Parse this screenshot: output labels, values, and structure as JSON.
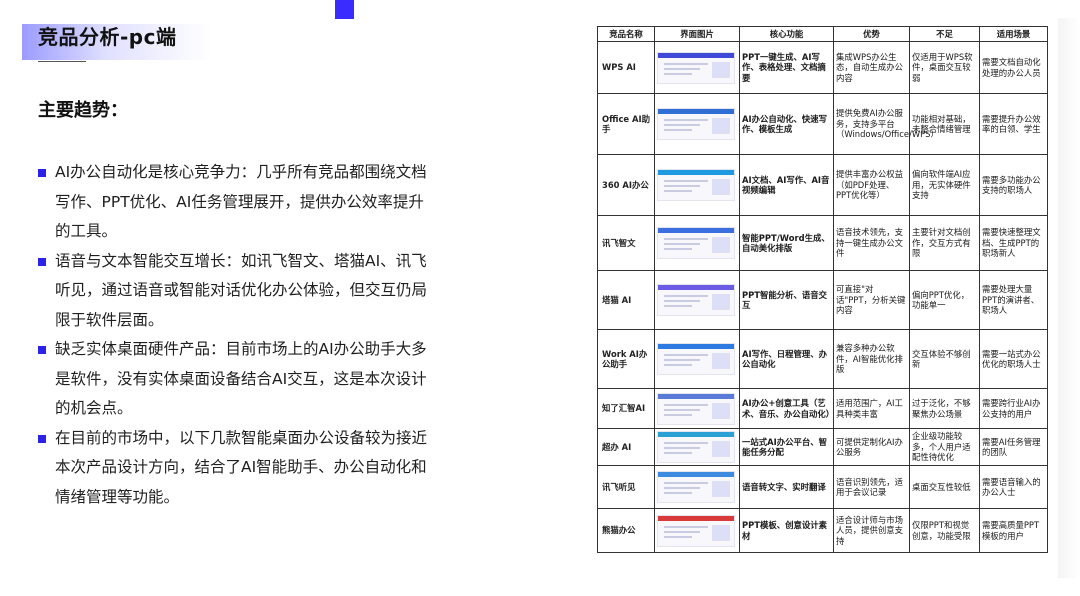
{
  "page": {
    "title": "竞品分析-pc端",
    "section_heading": "主要趋势：",
    "trends": [
      "AI办公自动化是核心竞争力：几乎所有竞品都围绕文档写作、PPT优化、AI任务管理展开，提供办公效率提升的工具。",
      "语音与文本智能交互增长：如讯飞智文、塔猫AI、讯飞听见，通过语音或智能对话优化办公体验，但交互仍局限于软件层面。",
      "缺乏实体桌面硬件产品：目前市场上的AI办公助手大多是软件，没有实体桌面设备结合AI交互，这是本次设计的机会点。",
      "在目前的市场中，以下几款智能桌面办公设备较为接近本次产品设计方向，结合了AI智能助手、办公自动化和情绪管理等功能。"
    ]
  },
  "colors": {
    "accent": "#3a2bff",
    "bullet": "#2a22e6"
  },
  "table": {
    "headers": [
      "竞品名称",
      "界面图片",
      "核心功能",
      "优势",
      "不足",
      "适用场景"
    ],
    "rows": [
      {
        "name": "WPS AI",
        "func": "PPT一键生成、AI写作、表格处理、文档摘要",
        "adv": "集成WPS办公生态，自动生成办公内容",
        "dis": "仅适用于WPS软件，桌面交互较弱",
        "scene": "需要文档自动化处理的办公人员",
        "thumb": "wps-ai-screenshot"
      },
      {
        "name": "Office AI助手",
        "func": "AI办公自动化、快速写作、模板生成",
        "adv": "提供免费AI办公服务，支持多平台（Windows/Office/WPS）",
        "dis": "功能相对基础，未整合情绪管理",
        "scene": "需要提升办公效率的白领、学生",
        "thumb": "office-ai-screenshot"
      },
      {
        "name": "360 AI办公",
        "func": "AI文档、AI写作、AI音视频编辑",
        "adv": "提供丰富办公权益（如PDF处理、PPT优化等）",
        "dis": "偏向软件端AI应用，无实体硬件支持",
        "scene": "需要多功能办公支持的职场人",
        "thumb": "360-ai-screenshot"
      },
      {
        "name": "讯飞智文",
        "func": "智能PPT/Word生成、自动美化排版",
        "adv": "语音技术领先，支持一键生成办公文件",
        "dis": "主要针对文档创作，交互方式有限",
        "scene": "需要快速整理文档、生成PPT的职场新人",
        "thumb": "xunfei-zhiwen-screenshot"
      },
      {
        "name": "塔猫 AI",
        "func": "PPT智能分析、语音交互",
        "adv": "可直接\"对话\"PPT，分析关键内容",
        "dis": "偏向PPT优化，功能单一",
        "scene": "需要处理大量PPT的演讲者、职场人",
        "thumb": "tamao-ai-screenshot"
      },
      {
        "name": "Work AI办公助手",
        "func": "AI写作、日程管理、办公自动化",
        "adv": "兼容多种办公软件，AI智能优化排版",
        "dis": "交互体验不够创新",
        "scene": "需要一站式办公优化的职场人士",
        "thumb": "work-ai-screenshot"
      },
      {
        "name": "知了汇智AI",
        "func": "AI办公+创意工具（艺术、音乐、办公自动化）",
        "adv": "适用范围广，AI工具种类丰富",
        "dis": "过于泛化，不够聚焦办公场景",
        "scene": "需要跨行业AI办公支持的用户",
        "thumb": "zhiliao-ai-screenshot"
      },
      {
        "name": "超办 AI",
        "func": "一站式AI办公平台、智能任务分配",
        "adv": "可提供定制化AI办公服务",
        "dis": "企业级功能较多，个人用户适配性待优化",
        "scene": "需要AI任务管理的团队",
        "thumb": "chaoban-ai-screenshot"
      },
      {
        "name": "讯飞听见",
        "func": "语音转文字、实时翻译",
        "adv": "语音识别领先，适用于会议记录",
        "dis": "桌面交互性较低",
        "scene": "需要语音输入的办公人士",
        "thumb": "xunfei-tingjian-screenshot"
      },
      {
        "name": "熊猫办公",
        "func": "PPT模板、创意设计素材",
        "adv": "适合设计师与市场人员，提供创意支持",
        "dis": "仅限PPT和视觉创意，功能受限",
        "scene": "需要高质量PPT模板的用户",
        "thumb": "xiongmao-screenshot"
      }
    ]
  }
}
